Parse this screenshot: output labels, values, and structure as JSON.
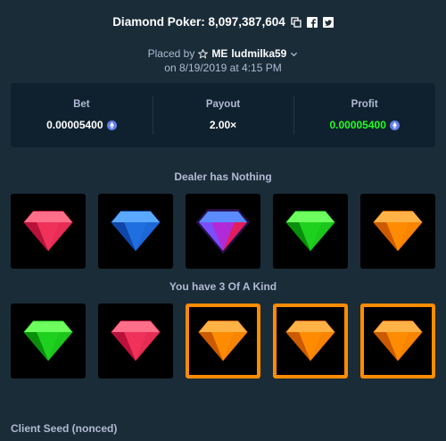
{
  "header": {
    "title": "Diamond Poker: 8,097,387,604",
    "icons": [
      "copy-icon",
      "facebook-icon",
      "twitter-icon"
    ]
  },
  "placed": {
    "prefix": "Placed by",
    "badge": "ME",
    "username": "ludmilka59",
    "date_line": "on 8/19/2019 at 4:15 PM"
  },
  "stats": {
    "bet_label": "Bet",
    "bet_value": "0.00005400",
    "payout_label": "Payout",
    "payout_value": "2.00×",
    "profit_label": "Profit",
    "profit_value": "0.00005400"
  },
  "dealer": {
    "title": "Dealer has Nothing",
    "gems": [
      "red",
      "blue",
      "purple",
      "green",
      "orange"
    ]
  },
  "player": {
    "title": "You have 3 Of A Kind",
    "gems": [
      "green",
      "red",
      "orange",
      "orange",
      "orange"
    ],
    "winning": [
      false,
      false,
      true,
      true,
      true
    ]
  },
  "footer": {
    "seed_label": "Client Seed (nonced)"
  },
  "colors": {
    "background": "#1a2c38",
    "panel": "#0f212e",
    "profit_green": "#1fff20",
    "win_border": "#ff8c00"
  }
}
